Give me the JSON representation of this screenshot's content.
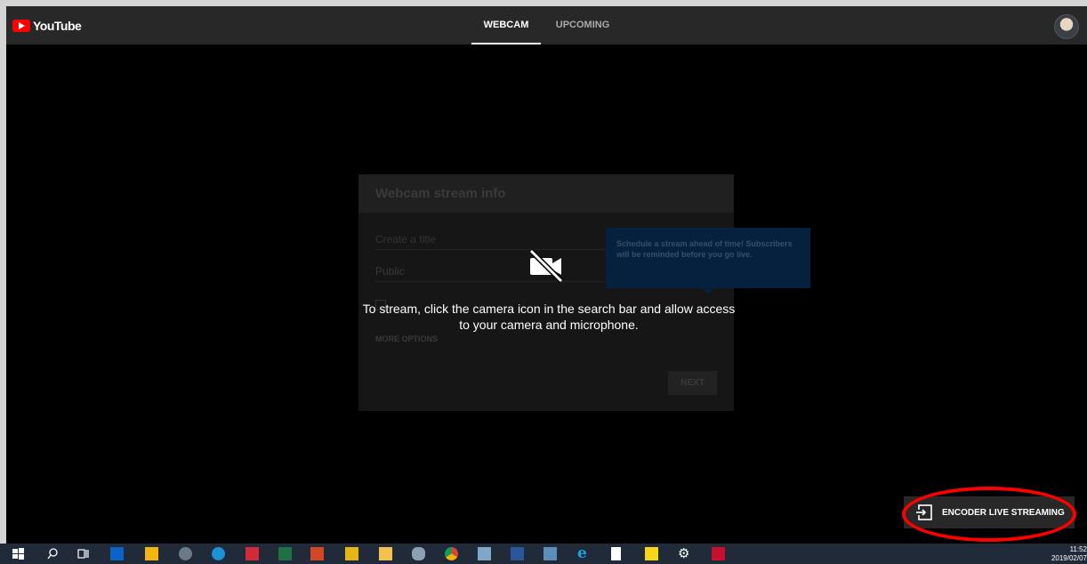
{
  "app": {
    "logo_text": "YouTube"
  },
  "tabs": [
    {
      "label": "WEBCAM",
      "active": true
    },
    {
      "label": "UPCOMING",
      "active": false
    }
  ],
  "dialog": {
    "title": "Webcam stream info",
    "title_placeholder": "Create a title",
    "privacy_value": "Public",
    "more_options": "MORE OPTIONS",
    "next_label": "NEXT"
  },
  "tooltip": {
    "text": "Schedule a stream ahead of time! Subscribers will be reminded before you go live."
  },
  "overlay": {
    "message": "To stream, click the camera icon in the search bar and allow access to your camera and microphone."
  },
  "encoder": {
    "label": "ENCODER LIVE STREAMING"
  },
  "taskbar": {
    "icons": [
      "windows-start-icon",
      "search-icon",
      "task-view-icon",
      "outlook-icon",
      "sticky-icon",
      "app-icon",
      "skype-icon",
      "app-icon",
      "excel-icon",
      "powerpoint-icon",
      "app-icon",
      "file-explorer-icon",
      "app-icon",
      "chrome-icon",
      "app-icon",
      "word-icon",
      "app-icon",
      "internet-explorer-icon",
      "document-icon",
      "sticky-notes-icon",
      "settings-icon",
      "acrobat-icon"
    ],
    "time": "11:52",
    "date": "2019/02/07"
  },
  "colors": {
    "accent_red": "#ff0000",
    "topbar": "#282828",
    "taskbar": "#202a38"
  }
}
